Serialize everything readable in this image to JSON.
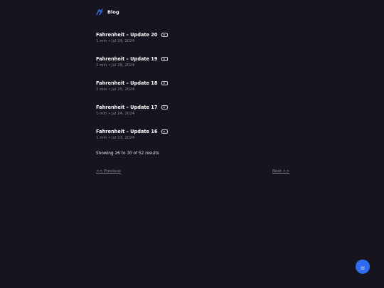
{
  "header": {
    "brand": "Blog",
    "logo_icon": "logo-icon"
  },
  "posts": [
    {
      "title": "Fahrenheit – Update 20",
      "meta": "1 min • Jul 29, 2024",
      "badge_icon": "video-play-icon"
    },
    {
      "title": "Fahrenheit – Update 19",
      "meta": "1 min • Jul 26, 2024",
      "badge_icon": "video-play-icon"
    },
    {
      "title": "Fahrenheit – Update 18",
      "meta": "1 min • Jul 25, 2024",
      "badge_icon": "video-play-icon"
    },
    {
      "title": "Fahrenheit – Update 17",
      "meta": "1 min • Jul 24, 2024",
      "badge_icon": "video-play-icon"
    },
    {
      "title": "Fahrenheit – Update 16",
      "meta": "1 min • Jul 23, 2024",
      "badge_icon": "video-play-icon"
    }
  ],
  "results": {
    "text": "Showing 26 to 30 of 52 results"
  },
  "pagination": {
    "prev_label": "<< Previous",
    "next_label": "Next >>"
  },
  "fab": {
    "icon": "chat-icon"
  },
  "colors": {
    "background": "#16151f",
    "accent": "#2f6bf0",
    "muted_text": "#8c8b99",
    "text": "#ffffff"
  }
}
